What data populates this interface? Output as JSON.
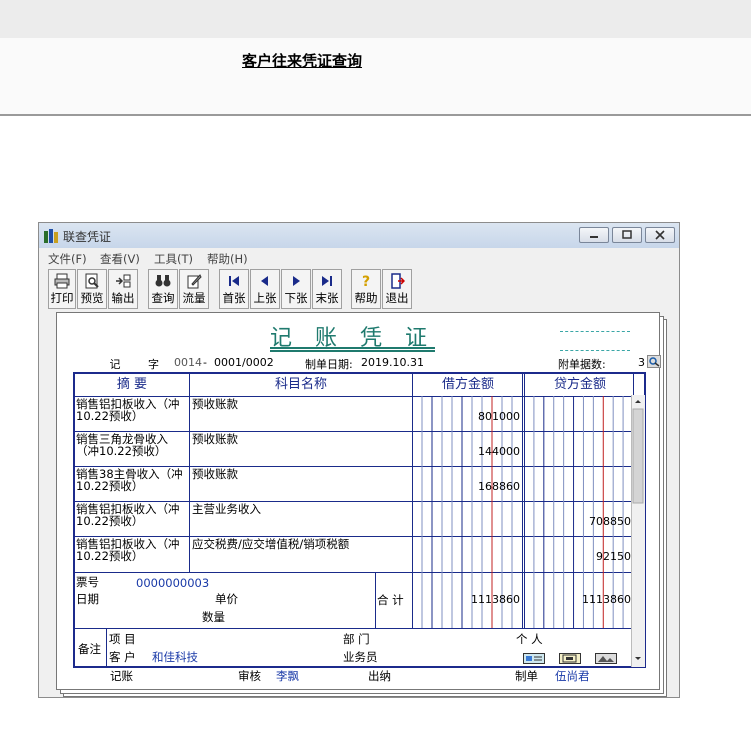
{
  "page": {
    "title": "客户往来凭证查询"
  },
  "window": {
    "title": "联查凭证",
    "menu": [
      "文件(F)",
      "查看(V)",
      "工具(T)",
      "帮助(H)"
    ],
    "toolbar": [
      "打印",
      "预览",
      "输出",
      "查询",
      "流量",
      "首张",
      "上张",
      "下张",
      "末张",
      "帮助",
      "退出"
    ]
  },
  "voucher": {
    "title": "记 账 凭 证",
    "type": "记",
    "zi": "字",
    "number": "0014",
    "dash": "-",
    "page_no": "0001/0002",
    "date_label": "制单日期:",
    "date": "2019.10.31",
    "attachments_label": "附单据数:",
    "attachments": "3",
    "headers": {
      "summary": "摘 要",
      "account": "科目名称",
      "debit": "借方金额",
      "credit": "贷方金额"
    },
    "rows": [
      {
        "summary": "销售铝扣板收入（冲10.22预收）",
        "account": "预收账款",
        "debit": "801000",
        "credit": ""
      },
      {
        "summary": "销售三角龙骨收入（冲10.22预收）",
        "account": "预收账款",
        "debit": "144000",
        "credit": ""
      },
      {
        "summary": "销售38主骨收入（冲10.22预收）",
        "account": "预收账款",
        "debit": "168860",
        "credit": ""
      },
      {
        "summary": "销售铝扣板收入（冲10.22预收）",
        "account": "主营业务收入",
        "debit": "",
        "credit": "708850"
      },
      {
        "summary": "销售铝扣板收入（冲10.22预收）",
        "account": "应交税费/应交增值税/销项税额",
        "debit": "",
        "credit": "92150"
      }
    ],
    "ticket_label": "票号",
    "ticket_no": "0000000003",
    "date_row_label": "日期",
    "price_label": "单价",
    "qty_label": "数量",
    "total_label": "合 计",
    "total_debit": "1113860",
    "total_credit": "1113860",
    "remark_label": "备注",
    "project_label": "项 目",
    "dept_label": "部 门",
    "person_label": "个 人",
    "customer_label": "客 户",
    "customer": "和佳科技",
    "salesman_label": "业务员",
    "bookkeeper_label": "记账",
    "reviewer_label": "审核",
    "reviewer": "李飘",
    "cashier_label": "出纳",
    "maker_label": "制单",
    "maker": "伍尚君"
  },
  "colors": {
    "accent": "#1f7a6e",
    "grid": "#1a2b8a",
    "value_blue": "#1a3aa8"
  }
}
